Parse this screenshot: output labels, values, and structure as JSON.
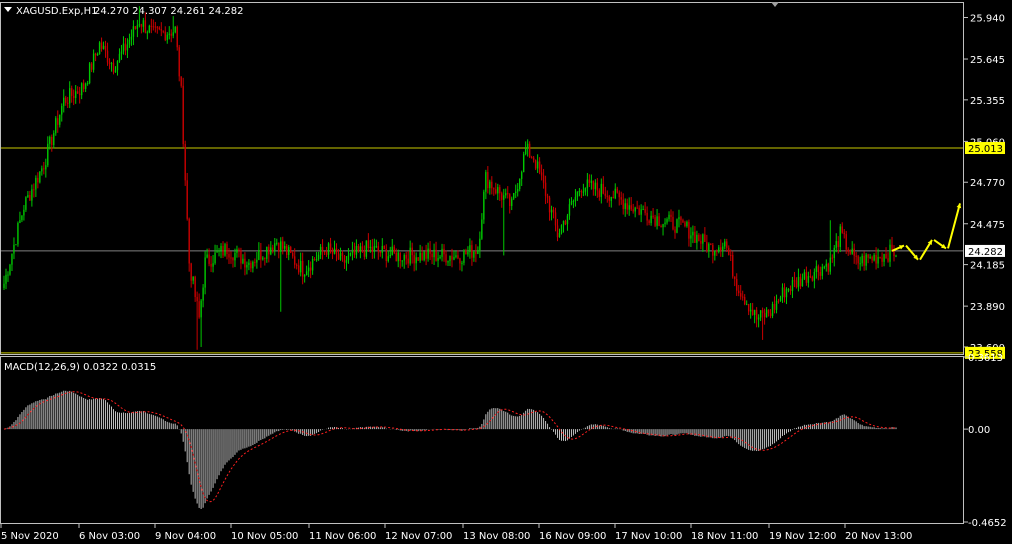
{
  "header": {
    "symbol_label": "XAGUSD.Exp,H1",
    "ohlc_label": "24.270 24.307 24.261 24.282",
    "macd_label": "MACD(12,26,9) 0.0322 0.0315"
  },
  "colors": {
    "background": "#000000",
    "frame": "#c0c0c0",
    "bull": "#00c800",
    "bear": "#c80000",
    "level_line": "#c8c800",
    "level_label_bg": "#ffff00",
    "bid_line": "#808080",
    "histogram": "#c0c0c0",
    "signal": "#ff2020",
    "arrow": "#ffff00"
  },
  "chart_data": [
    {
      "type": "candlestick",
      "title": "XAGUSD.Exp,H1",
      "ylim": [
        23.55,
        26.05
      ],
      "y_ticks": [
        25.94,
        25.645,
        25.355,
        25.06,
        24.77,
        24.475,
        24.185,
        23.89,
        23.6
      ],
      "y_tick_labels": [
        "25.940",
        "25.645",
        "25.355",
        "25.060",
        "24.770",
        "24.475",
        "24.185",
        "23.890",
        "23.600"
      ],
      "x_ticks": [
        "5 Nov 2020",
        "6 Nov 03:00",
        "9 Nov 04:00",
        "10 Nov 05:00",
        "11 Nov 06:00",
        "12 Nov 07:00",
        "13 Nov 08:00",
        "16 Nov 09:00",
        "17 Nov 10:00",
        "18 Nov 11:00",
        "19 Nov 12:00",
        "20 Nov 13:00"
      ],
      "close_anchors": [
        [
          0,
          24.05
        ],
        [
          10,
          24.6
        ],
        [
          20,
          24.9
        ],
        [
          30,
          25.35
        ],
        [
          40,
          25.45
        ],
        [
          48,
          25.75
        ],
        [
          55,
          25.6
        ],
        [
          60,
          25.7
        ],
        [
          68,
          25.92
        ],
        [
          75,
          25.82
        ],
        [
          86,
          25.85
        ],
        [
          89,
          25.4
        ],
        [
          93,
          24.2
        ],
        [
          98,
          23.8
        ],
        [
          101,
          24.2
        ],
        [
          112,
          24.3
        ],
        [
          123,
          24.2
        ],
        [
          137,
          24.35
        ],
        [
          150,
          24.15
        ],
        [
          162,
          24.3
        ],
        [
          170,
          24.2
        ],
        [
          182,
          24.3
        ],
        [
          196,
          24.25
        ],
        [
          210,
          24.25
        ],
        [
          230,
          24.25
        ],
        [
          238,
          24.3
        ],
        [
          242,
          24.8
        ],
        [
          255,
          24.6
        ],
        [
          262,
          25.0
        ],
        [
          266,
          24.95
        ],
        [
          272,
          24.7
        ],
        [
          278,
          24.4
        ],
        [
          290,
          24.75
        ],
        [
          303,
          24.7
        ],
        [
          315,
          24.6
        ],
        [
          330,
          24.5
        ],
        [
          342,
          24.45
        ],
        [
          355,
          24.3
        ],
        [
          362,
          24.35
        ],
        [
          368,
          24.05
        ],
        [
          378,
          23.8
        ],
        [
          385,
          23.85
        ],
        [
          392,
          24.0
        ],
        [
          402,
          24.1
        ],
        [
          415,
          24.2
        ],
        [
          420,
          24.4
        ],
        [
          428,
          24.2
        ],
        [
          440,
          24.25
        ],
        [
          448,
          24.28
        ]
      ],
      "level_lines": [
        {
          "value": 25.013,
          "label": "25.013"
        },
        {
          "value": 23.558,
          "label": "23.558"
        }
      ],
      "bid_line": {
        "value": 24.282,
        "label": "24.282"
      },
      "forecast_arrows": [
        [
          24.282,
          24.32
        ],
        [
          24.32,
          24.22
        ],
        [
          24.22,
          24.36
        ],
        [
          24.36,
          24.3
        ],
        [
          24.3,
          24.62
        ]
      ]
    },
    {
      "type": "histogram",
      "title": "MACD(12,26,9) 0.0322 0.0315",
      "ylim": [
        -0.4652,
        0.3613
      ],
      "y_ticks": [
        0.3613,
        0.0,
        -0.4652
      ],
      "y_tick_labels": [
        "0.3613",
        "0.00",
        "-0.4652"
      ],
      "series": [
        {
          "name": "MACD",
          "values": [
            0.0322
          ]
        },
        {
          "name": "Signal",
          "values": [
            0.0315
          ]
        }
      ]
    }
  ]
}
